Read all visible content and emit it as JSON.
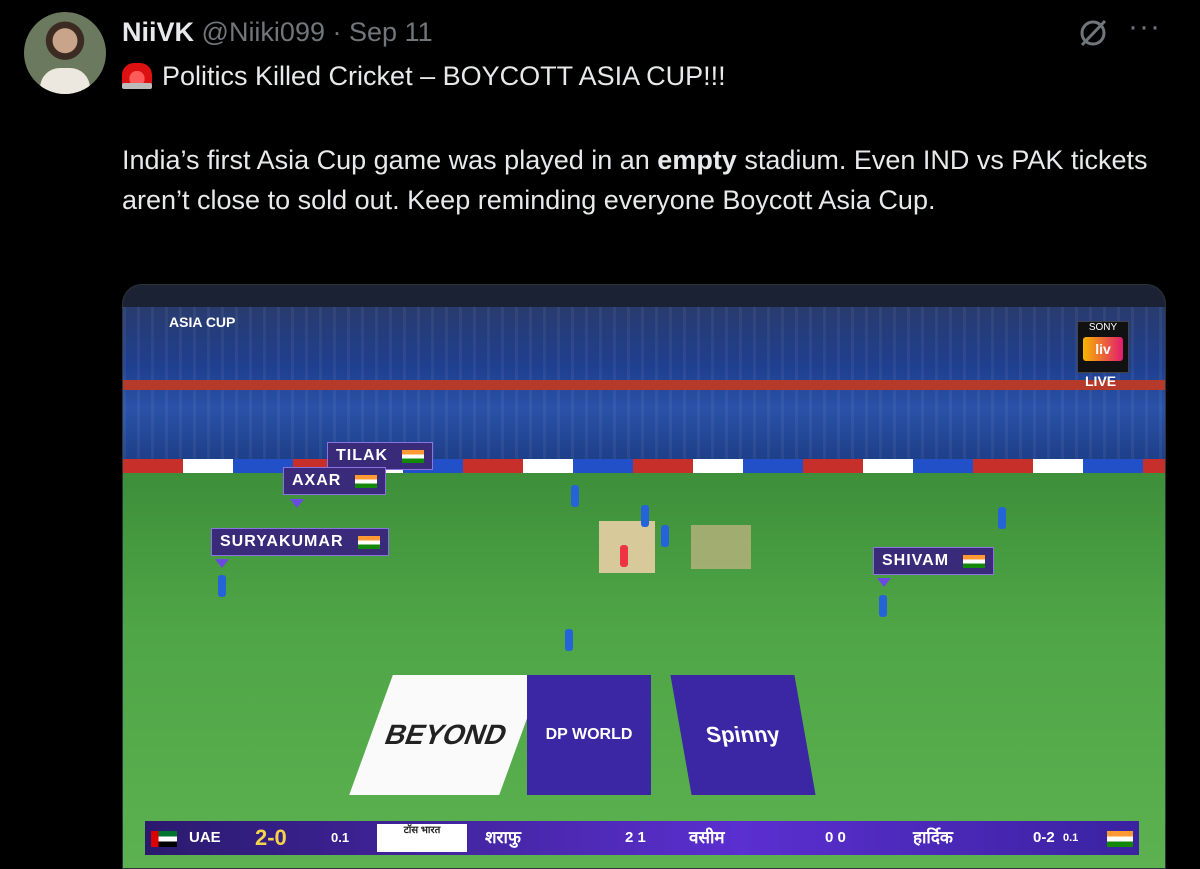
{
  "tweet": {
    "display_name": "NiiVK",
    "handle": "@Niiki099",
    "separator": "·",
    "date": "Sep 11",
    "headline": "Politics Killed Cricket – BOYCOTT ASIA CUP!!!",
    "body_part1": "India’s first Asia Cup game was played in an ",
    "body_bold": "empty",
    "body_part2": " stadium. Even IND vs PAK tickets aren’t close to sold out. Keep reminding everyone  Boycott Asia Cup.",
    "more_label": "···"
  },
  "image": {
    "event_logo": "ASIA CUP",
    "broadcaster": "SONY",
    "stream_logo": "liv",
    "live_label": "LIVE",
    "player_tags": [
      "TILAK",
      "AXAR",
      "SURYAKUMAR",
      "SHIVAM"
    ],
    "mats": [
      "BEYOND",
      "DP WORLD",
      "Spinny"
    ],
    "scorebar": {
      "team": "UAE",
      "score": "2-0",
      "overs": "0.1",
      "toss": "टॉस भारत",
      "batter1": "शराफु",
      "batter1_score": "2 1",
      "batter2": "वसीम",
      "batter2_score": "0 0",
      "bowler": "हार्दिक",
      "bowler_figures": "0-2",
      "bowler_overs": "0.1"
    }
  },
  "colors": {
    "background": "#000000",
    "text": "#e7e9ea",
    "muted": "#71767b"
  }
}
